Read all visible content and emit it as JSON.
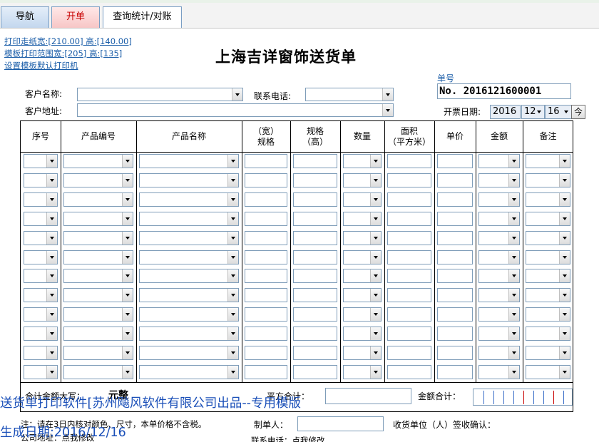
{
  "tabs": [
    {
      "label": "导航"
    },
    {
      "label": "开单"
    },
    {
      "label": "查询统计/对账"
    }
  ],
  "print_links": [
    "打印走纸宽:[210.00] 高:[140.00]",
    "模板打印范围宽:[205] 高:[135]",
    "设置模板默认打印机"
  ],
  "title": "上海吉详窗饰送货单",
  "form": {
    "customer_name_label": "客户名称:",
    "customer_name_value": "",
    "phone_label": "联系电话:",
    "phone_value": "",
    "address_label": "客户地址:",
    "address_value": "",
    "order_no_label": "单号",
    "order_no": "No. 2016121600001",
    "date_label": "开票日期:",
    "date_year": "2016",
    "date_month": "12",
    "date_day": "16",
    "today_button": "今"
  },
  "table": {
    "columns": [
      {
        "label": "序号"
      },
      {
        "label": "产品编号"
      },
      {
        "label": "产品名称"
      },
      {
        "label": "（宽）\n规格"
      },
      {
        "label": "规格\n（高）"
      },
      {
        "label": "数量"
      },
      {
        "label": "面积\n（平方米）"
      },
      {
        "label": "单价"
      },
      {
        "label": "金额"
      },
      {
        "label": "备注"
      }
    ],
    "row_count": 12
  },
  "footer": {
    "total_uppercase_label": "合计金额大写：",
    "total_uppercase_value": "元整",
    "area_total_label": "平方合计：",
    "amount_total_label": "金额合计：",
    "note": "注：请在3日内核对颜色、尺寸，本单价格不含税。",
    "maker_label": "制单人：",
    "receiver_label": "收货单位（人）签收确认：",
    "company_address": "公司地址：点我修改",
    "contact_phone": "联系电话：点我修改"
  },
  "watermark": {
    "line1": "送货单打印软件[苏州飚风软件有限公司出品--专用模版",
    "line2": "生成日期:2016/12/16"
  },
  "colors": {
    "link": "#1a5da8",
    "watermark": "#1a4fb8",
    "active_tab_text": "#c80000"
  }
}
